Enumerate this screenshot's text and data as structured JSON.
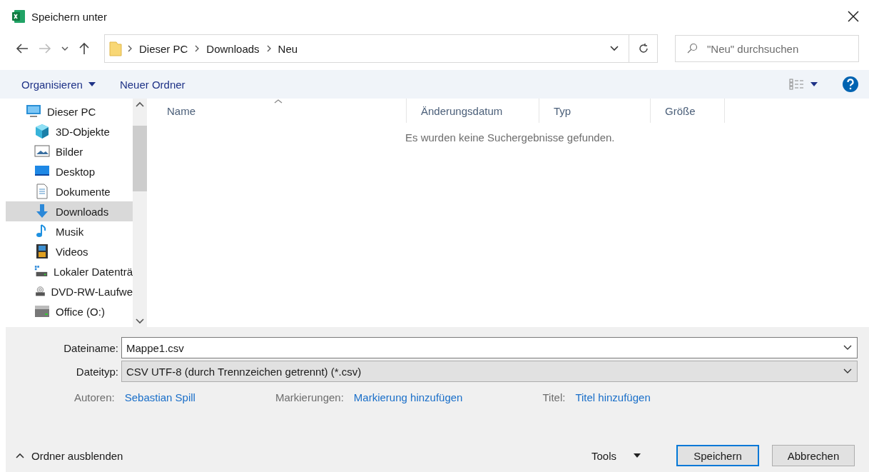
{
  "window": {
    "title": "Speichern unter"
  },
  "address": {
    "segments": [
      "Dieser PC",
      "Downloads",
      "Neu"
    ]
  },
  "search": {
    "placeholder": "\"Neu\" durchsuchen"
  },
  "toolbar": {
    "organize": "Organisieren",
    "new_folder": "Neuer Ordner"
  },
  "sidebar": {
    "items": [
      {
        "label": "Dieser PC",
        "kind": "pc",
        "selected": false,
        "children": [
          {
            "label": "3D-Objekte",
            "kind": "cube",
            "selected": false
          },
          {
            "label": "Bilder",
            "kind": "pictures",
            "selected": false
          },
          {
            "label": "Desktop",
            "kind": "desktop",
            "selected": false
          },
          {
            "label": "Dokumente",
            "kind": "document",
            "selected": false
          },
          {
            "label": "Downloads",
            "kind": "download",
            "selected": true
          },
          {
            "label": "Musik",
            "kind": "music",
            "selected": false
          },
          {
            "label": "Videos",
            "kind": "video",
            "selected": false
          },
          {
            "label": "Lokaler Datenträ",
            "kind": "drive",
            "selected": false
          },
          {
            "label": "DVD-RW-Laufwe",
            "kind": "dvd",
            "selected": false
          },
          {
            "label": "Office (O:)",
            "kind": "netdrive",
            "selected": false
          }
        ]
      }
    ]
  },
  "table": {
    "columns": [
      "Name",
      "Änderungsdatum",
      "Typ",
      "Größe"
    ],
    "empty_message": "Es wurden keine Suchergebnisse gefunden."
  },
  "form": {
    "filename_label": "Dateiname:",
    "filename": "Mappe1.csv",
    "filetype_label": "Dateityp:",
    "filetype": "CSV UTF-8 (durch Trennzeichen getrennt) (*.csv)",
    "meta": [
      {
        "label": "Autoren:",
        "value": "Sebastian Spill"
      },
      {
        "label": "Markierungen:",
        "value": "Markierung hinzufügen"
      },
      {
        "label": "Titel:",
        "value": "Titel hinzufügen"
      }
    ]
  },
  "footer": {
    "hide_folders": "Ordner ausblenden",
    "tools": "Tools",
    "buttons": [
      {
        "label": "Speichern",
        "selected": true
      },
      {
        "label": "Abbrechen",
        "selected": false
      }
    ]
  }
}
